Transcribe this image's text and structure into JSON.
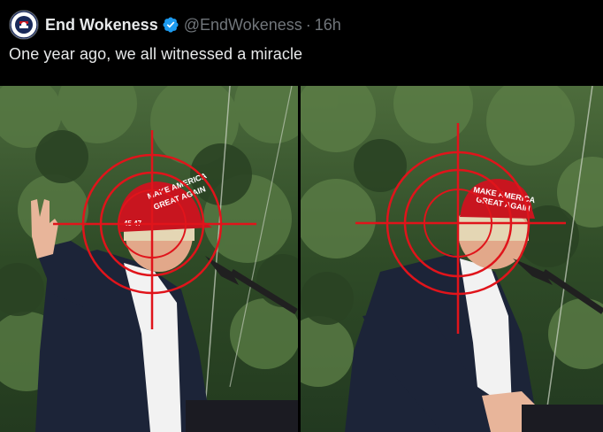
{
  "tweet": {
    "author_name": "End Wokeness",
    "handle": "@EndWokeness",
    "separator": "·",
    "time": "16h",
    "text": "One year ago, we all witnessed a miracle",
    "verified_icon": "verified-badge-icon",
    "avatar_icon": "avatar-logo",
    "avatar_text": "END WOKENESS"
  },
  "media": {
    "left_hat_text": "MAKE AMERICA GREAT AGAIN",
    "right_hat_text": "MAKE AMERICA GREAT AGAIN",
    "left_hat_side_text": "45 47"
  },
  "colors": {
    "background": "#000000",
    "text_primary": "#e7e9ea",
    "text_secondary": "#71767b",
    "verified": "#1d9bf0",
    "crosshair": "#e0141b",
    "hat": "#c8151f"
  }
}
